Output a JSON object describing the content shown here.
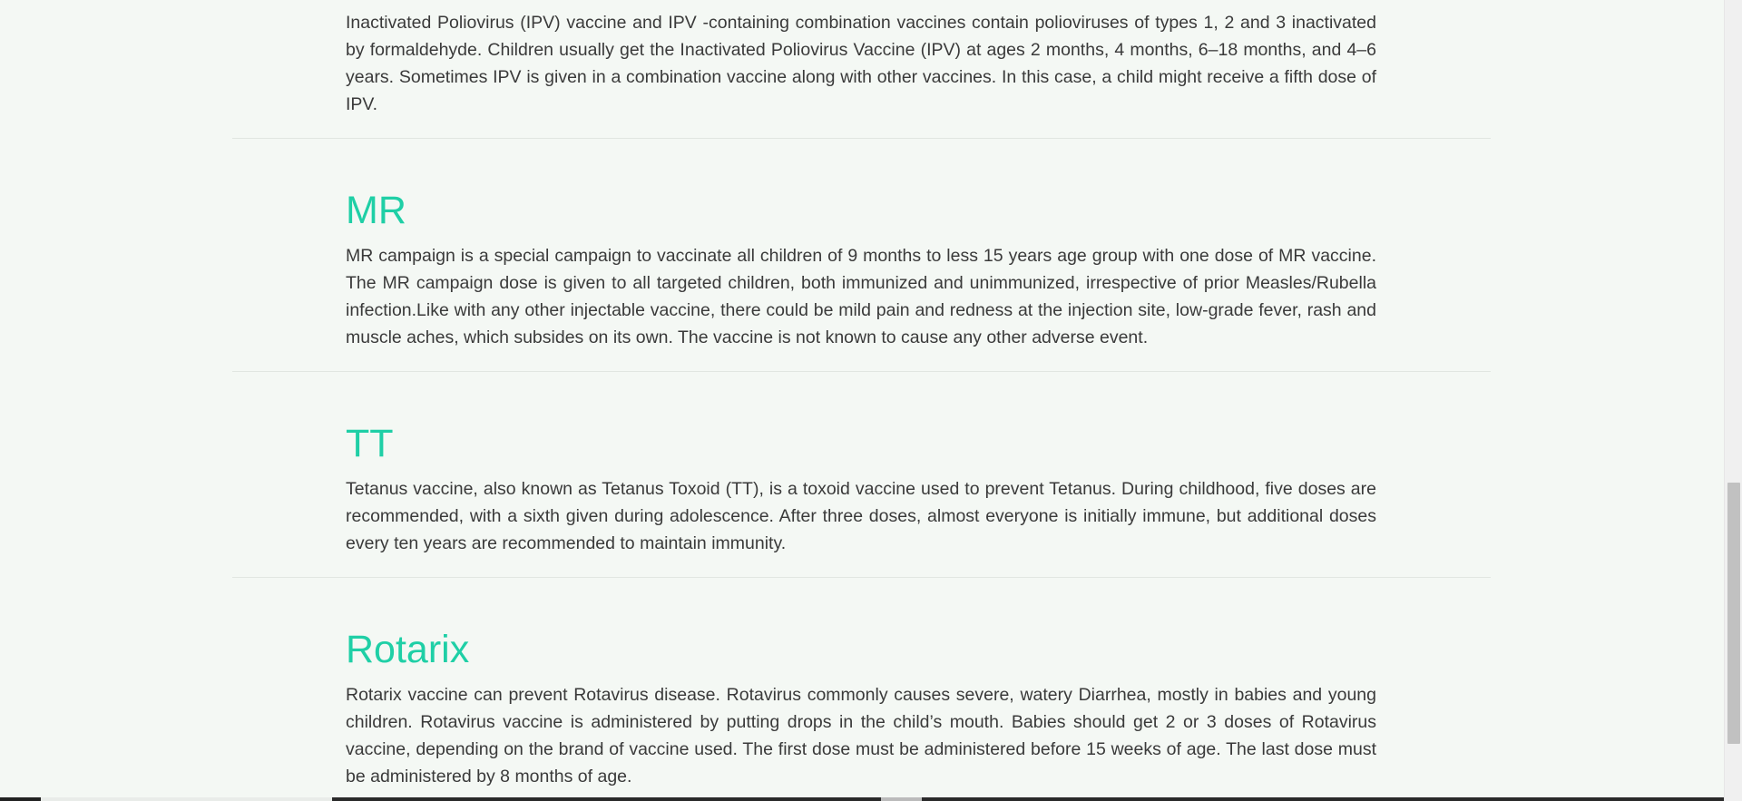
{
  "sections": [
    {
      "id": "ipv",
      "heading": "",
      "body": "Inactivated Poliovirus (IPV) vaccine and IPV -containing combination vaccines contain polioviruses of types 1, 2 and 3 inactivated by formaldehyde. Children usually get the Inactivated Poliovirus Vaccine (IPV) at ages 2 months, 4 months, 6–18 months, and 4–6 years. Sometimes IPV is given in a combination vaccine along with other vaccines. In this case, a child might receive a fifth dose of IPV."
    },
    {
      "id": "mr",
      "heading": "MR",
      "body": "MR campaign is a special campaign to vaccinate all children of 9 months to less 15 years age group with one dose of MR vaccine. The MR campaign dose is given to all targeted children, both immunized and unimmunized, irrespective of prior Measles/Rubella infection.Like with any other injectable vaccine, there could be mild pain and redness at the injection site, low-grade fever, rash and muscle aches, which subsides on its own. The vaccine is not known to cause any other adverse event."
    },
    {
      "id": "tt",
      "heading": "TT",
      "body": "Tetanus vaccine, also known as Tetanus Toxoid (TT), is a toxoid vaccine used to prevent Tetanus. During childhood, five doses are recommended, with a sixth given during adolescence. After three doses, almost everyone is initially immune, but additional doses every ten years are recommended to maintain immunity."
    },
    {
      "id": "rotarix",
      "heading": "Rotarix",
      "body": "Rotarix vaccine can prevent Rotavirus disease. Rotavirus commonly causes severe, watery Diarrhea, mostly in babies and young children. Rotavirus vaccine is administered by putting drops in the child’s mouth. Babies should get 2 or 3 doses of Rotavirus vaccine, depending on the brand of vaccine used. The first dose must be administered before 15 weeks of age. The last dose must be administered by 8 months of age."
    }
  ],
  "colors": {
    "heading": "#1fcfa6",
    "body_text": "#3a3a3a",
    "background": "#f4f8f4",
    "divider": "#e1e6e1"
  }
}
